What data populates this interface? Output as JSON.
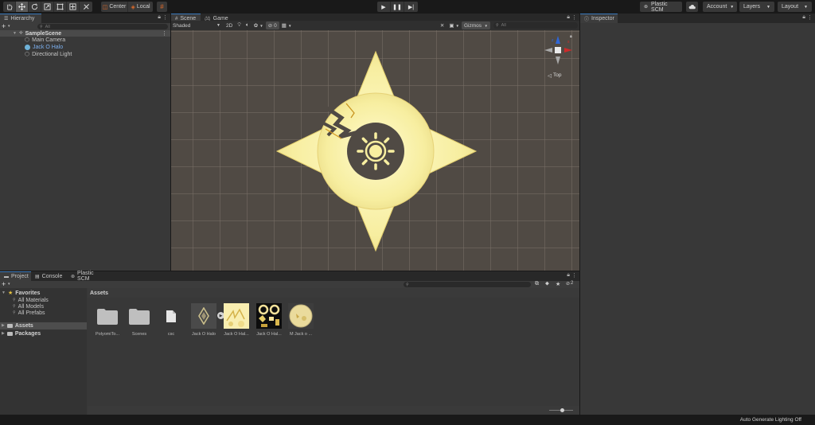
{
  "toolbar": {
    "tools": [
      "hand-tool",
      "move-tool",
      "rotate-tool",
      "scale-tool",
      "rect-tool",
      "transform-tool",
      "custom-tool"
    ],
    "pivot_label": "Center",
    "space_label": "Local",
    "plastic_label": "Plastic SCM",
    "account_label": "Account",
    "layers_label": "Layers",
    "layout_label": "Layout"
  },
  "hierarchy": {
    "tab_label": "Hierarchy",
    "search_placeholder": "All",
    "scene_name": "SampleScene",
    "items": [
      {
        "label": "Main Camera",
        "color": "#c4c4c4"
      },
      {
        "label": "Jack O Halo",
        "color": "#7cb0ef"
      },
      {
        "label": "Directional Light",
        "color": "#c4c4c4"
      }
    ]
  },
  "scene": {
    "tabs": [
      "Scene",
      "Game"
    ],
    "shading_mode": "Shaded",
    "mode_2d": "2D",
    "hidden_count": "0",
    "gizmos_label": "Gizmos",
    "search_placeholder": "All",
    "orientation_label": "Top",
    "accent_color": "#f8efa0"
  },
  "inspector": {
    "tab_label": "Inspector"
  },
  "project": {
    "tabs": [
      "Project",
      "Console",
      "Plastic SCM"
    ],
    "favorites_label": "Favorites",
    "favorites": [
      "All Materials",
      "All Models",
      "All Prefabs"
    ],
    "assets_label": "Assets",
    "packages_label": "Packages",
    "breadcrumb": "Assets",
    "visible_count": "2",
    "assets": [
      {
        "label": "PolyomiTo...",
        "kind": "folder"
      },
      {
        "label": "Scenes",
        "kind": "folder"
      },
      {
        "label": "csc",
        "kind": "file"
      },
      {
        "label": "Jack O Halo",
        "kind": "prefab"
      },
      {
        "label": "Jack O Hal...",
        "kind": "texture"
      },
      {
        "label": "Jack O Hal...",
        "kind": "texture-dark"
      },
      {
        "label": "M Jack o ...",
        "kind": "material"
      }
    ]
  },
  "status": {
    "right_text": "Auto Generate Lighting Off"
  }
}
